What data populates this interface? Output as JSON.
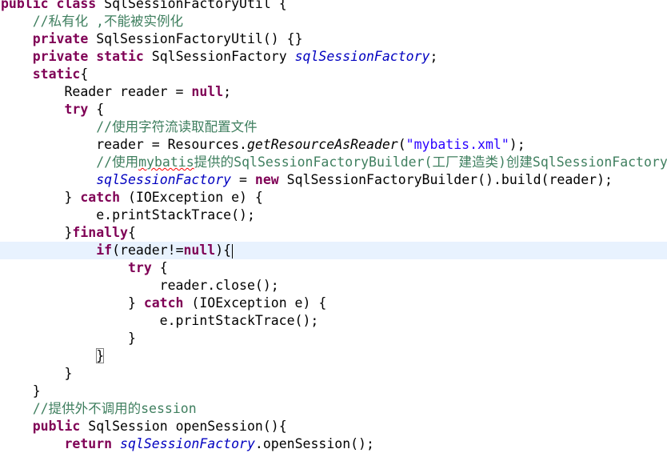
{
  "editor": {
    "current_line": 14,
    "lines": [
      [
        {
          "t": "public",
          "c": "kw"
        },
        {
          "t": " "
        },
        {
          "t": "class",
          "c": "kw"
        },
        {
          "t": " SqlSessionFactoryUtil {"
        }
      ],
      [
        {
          "t": "    "
        },
        {
          "t": "//私有化 ,不能被实例化",
          "c": "cm"
        }
      ],
      [
        {
          "t": "    "
        },
        {
          "t": "private",
          "c": "kw"
        },
        {
          "t": " SqlSessionFactoryUtil() {}"
        }
      ],
      [
        {
          "t": "    "
        },
        {
          "t": "private",
          "c": "kw"
        },
        {
          "t": " "
        },
        {
          "t": "static",
          "c": "kw"
        },
        {
          "t": " SqlSessionFactory "
        },
        {
          "t": "sqlSessionFactory",
          "c": "fi"
        },
        {
          "t": ";"
        }
      ],
      [
        {
          "t": "    "
        },
        {
          "t": "static",
          "c": "kw"
        },
        {
          "t": "{"
        }
      ],
      [
        {
          "t": "        Reader reader = "
        },
        {
          "t": "null",
          "c": "kw"
        },
        {
          "t": ";"
        }
      ],
      [
        {
          "t": "        "
        },
        {
          "t": "try",
          "c": "kw"
        },
        {
          "t": " {"
        }
      ],
      [
        {
          "t": "            "
        },
        {
          "t": "//使用字符流读取配置文件",
          "c": "cm"
        }
      ],
      [
        {
          "t": "            reader = Resources."
        },
        {
          "t": "getResourceAsReader",
          "c": "sm"
        },
        {
          "t": "("
        },
        {
          "t": "\"mybatis.xml\"",
          "c": "st"
        },
        {
          "t": ");"
        }
      ],
      [
        {
          "t": "            "
        },
        {
          "t": "//使用",
          "c": "cm"
        },
        {
          "t": "mybatis",
          "c": "cm squiggle"
        },
        {
          "t": "提供的SqlSessionFactoryBuilder(工厂建造类)创建SqlSessionFactory",
          "c": "cm"
        }
      ],
      [
        {
          "t": "            "
        },
        {
          "t": "sqlSessionFactory",
          "c": "fi"
        },
        {
          "t": " = "
        },
        {
          "t": "new",
          "c": "kw"
        },
        {
          "t": " SqlSessionFactoryBuilder().build(reader);"
        }
      ],
      [
        {
          "t": "        } "
        },
        {
          "t": "catch",
          "c": "kw"
        },
        {
          "t": " (IOException e) {"
        }
      ],
      [
        {
          "t": "            e.printStackTrace();"
        }
      ],
      [
        {
          "t": "        }"
        },
        {
          "t": "finally",
          "c": "kw"
        },
        {
          "t": "{"
        }
      ],
      [
        {
          "t": "            "
        },
        {
          "t": "if",
          "c": "kw"
        },
        {
          "t": "(reader!="
        },
        {
          "t": "null",
          "c": "kw"
        },
        {
          "t": "){",
          "caret": true
        }
      ],
      [
        {
          "t": "                "
        },
        {
          "t": "try",
          "c": "kw"
        },
        {
          "t": " {"
        }
      ],
      [
        {
          "t": "                    reader.close();"
        }
      ],
      [
        {
          "t": "                } "
        },
        {
          "t": "catch",
          "c": "kw"
        },
        {
          "t": " (IOException e) {"
        }
      ],
      [
        {
          "t": "                    e.printStackTrace();"
        }
      ],
      [
        {
          "t": "                }"
        }
      ],
      [
        {
          "t": "            "
        },
        {
          "t": "}",
          "c": "bracket-box"
        }
      ],
      [
        {
          "t": "        }"
        }
      ],
      [
        {
          "t": "    }"
        }
      ],
      [
        {
          "t": "    "
        },
        {
          "t": "//提供外不调用的session",
          "c": "cm"
        }
      ],
      [
        {
          "t": "    "
        },
        {
          "t": "public",
          "c": "kw"
        },
        {
          "t": " SqlSession openSession(){"
        }
      ],
      [
        {
          "t": "        "
        },
        {
          "t": "return",
          "c": "kw"
        },
        {
          "t": " "
        },
        {
          "t": "sqlSessionFactory",
          "c": "fi"
        },
        {
          "t": ".openSession();"
        }
      ]
    ]
  }
}
